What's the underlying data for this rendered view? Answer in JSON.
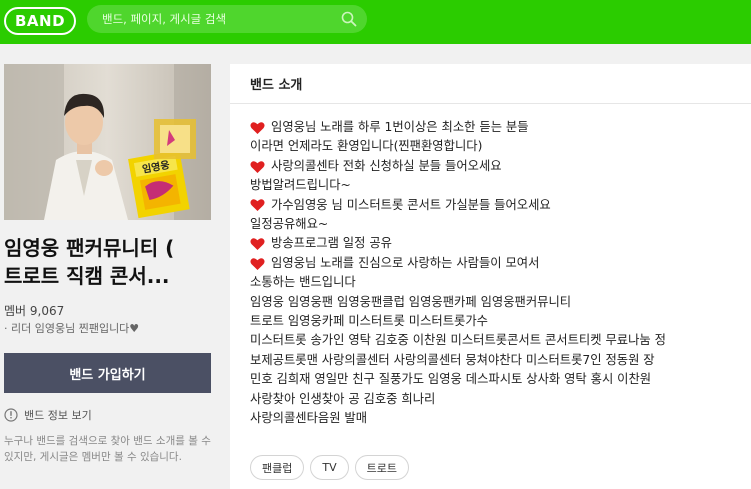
{
  "header": {
    "logo": "BAND",
    "search_placeholder": "밴드, 페이지, 게시글 검색",
    "search_icon": "search-icon"
  },
  "sidebar": {
    "cover_badge": "임영웅",
    "title_line1": "임영웅 팬커뮤니티 (",
    "title_line2": "트로트 직캠 콘서...",
    "members": "멤버 9,067",
    "leader": "· 리더 임영웅님 찐팬입니다♥",
    "join_button": "밴드 가입하기",
    "info_link": "밴드 정보 보기",
    "info_icon": "info-circle-icon",
    "notice": "누구나 밴드를 검색으로 찾아 밴드 소개를 볼 수 있지만, 게시글은 멤버만 볼 수 있습니다."
  },
  "main": {
    "section_title": "밴드 소개",
    "description": [
      {
        "heart": true,
        "text": "임영웅님 노래를 하루 1번이상은 최소한 듣는 분들"
      },
      {
        "heart": false,
        "text": "이라면 언제라도 환영입니다(찐팬환영합니다)"
      },
      {
        "heart": true,
        "text": "사랑의콜센타 전화 신청하실 분들 들어오세요"
      },
      {
        "heart": false,
        "text": "방법알려드립니다~"
      },
      {
        "heart": true,
        "text": "가수임영웅 님 미스터트롯 콘서트 가실분들 들어오세요"
      },
      {
        "heart": false,
        "text": "일정공유해요~"
      },
      {
        "heart": true,
        "text": "방송프로그램 일정 공유"
      },
      {
        "heart": true,
        "text": "임영웅님 노래를 진심으로 사랑하는 사람들이 모여서"
      },
      {
        "heart": false,
        "text": "소통하는 밴드입니다"
      },
      {
        "heart": false,
        "text": "임영웅 임영웅팬 임영웅팬클럽 임영웅팬카페 임영웅팬커뮤니티"
      },
      {
        "heart": false,
        "text": "트로트 임영웅카페 미스터트롯 미스터트롯가수"
      },
      {
        "heart": false,
        "text": "미스터트롯 송가인 영탁 김호중 이찬원 미스터트롯콘서트 콘서트티켓 무료나눔 정"
      },
      {
        "heart": false,
        "text": "보제공트롯맨 사랑의콜센터 사랑의콜센터 뭉쳐야찬다 미스터트롯7인 정동원 장"
      },
      {
        "heart": false,
        "text": "민호 김희재 영일만 친구 질풍가도 임영웅 데스파시토 상사화 영탁 홍시 이찬원"
      },
      {
        "heart": false,
        "text": "사랑찾아 인생찾아 공 김호중 희나리"
      },
      {
        "heart": false,
        "text": "사랑의콜센타음원 발매"
      }
    ],
    "heart_icon": "heart-icon",
    "tags": [
      "팬클럽",
      "TV",
      "트로트"
    ]
  },
  "colors": {
    "brand_green": "#2bcc00",
    "join_button": "#4b5064",
    "heart_red": "#e02020"
  }
}
